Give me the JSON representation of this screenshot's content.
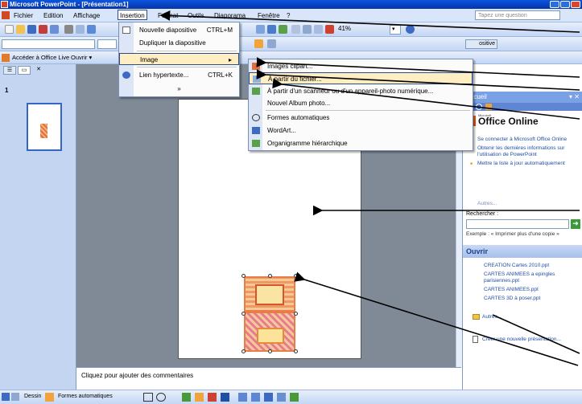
{
  "window": {
    "title": "Microsoft PowerPoint - [Présentation1]"
  },
  "menubar": {
    "items": [
      "Fichier",
      "Edition",
      "Affichage",
      "Insertion",
      "Format",
      "Outils",
      "Diaporama",
      "Fenêtre",
      "?"
    ],
    "search_placeholder": "Tapez une question"
  },
  "toolbar": {
    "zoom": "41%",
    "office_live_label": "Accéder à Office Live",
    "ouvrir_label": "Ouvrir"
  },
  "insert_menu": {
    "items": [
      {
        "label": "Nouvelle diapositive",
        "shortcut": "CTRL+M"
      },
      {
        "label": "Dupliquer la diapositive",
        "shortcut": ""
      },
      {
        "label": "Image",
        "shortcut": ""
      },
      {
        "label": "Lien hypertexte...",
        "shortcut": "CTRL+K"
      }
    ],
    "more": "»"
  },
  "image_submenu": {
    "items": [
      "Images clipart...",
      "À partir du fichier...",
      "À partir d'un scanneur ou d'un appareil-photo numérique...",
      "Nouvel Album photo...",
      "Formes automatiques",
      "WordArt...",
      "Organigramme hiérarchique"
    ]
  },
  "slides_pane": {
    "slide_number": "1"
  },
  "notes": {
    "placeholder": "Cliquez pour ajouter des commentaires"
  },
  "task_pane": {
    "title": "Accueil",
    "office_small": "Microsoft",
    "office_brand": "Office Online",
    "links": [
      "Se connecter à Microsoft Office Online",
      "Obtenir les dernières informations sur l'utilisation de PowerPoint",
      "Mettre la liste à jour automatiquement"
    ],
    "autres": "Autres...",
    "search_label": "Rechercher :",
    "example": "Exemple : « Imprimer plus d'une copie »",
    "open_header": "Ouvrir",
    "files": [
      "CREATION Cartes 2010.ppt",
      "CARTES ANIMEES a epingles parisiennes.ppt",
      "CARTES ANIMEES.ppt",
      "CARTES 3D à poser.ppt"
    ],
    "open_more": "Autres...",
    "create": "Créer une nouvelle présentation..."
  },
  "drawbar": {
    "dessin": "Dessin",
    "formes": "Formes automatiques"
  },
  "colors": {
    "titlebar": "#0a55e0",
    "menu_highlight": "#ffeec2",
    "accent": "#f39a1b"
  }
}
